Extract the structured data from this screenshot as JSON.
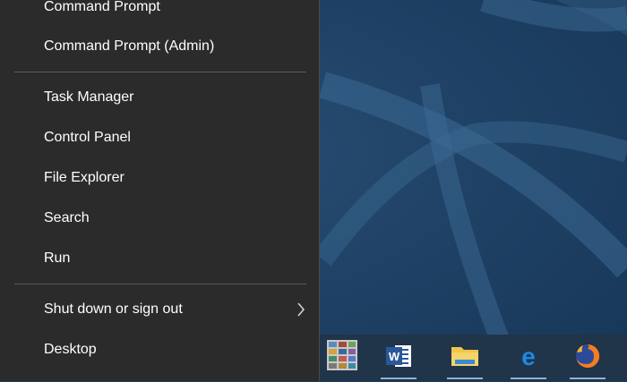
{
  "menu": {
    "items": [
      {
        "label": "Command Prompt"
      },
      {
        "label": "Command Prompt (Admin)"
      },
      {
        "label": "Task Manager"
      },
      {
        "label": "Control Panel"
      },
      {
        "label": "File Explorer"
      },
      {
        "label": "Search"
      },
      {
        "label": "Run"
      },
      {
        "label": "Shut down or sign out"
      },
      {
        "label": "Desktop"
      }
    ],
    "shutdown_submenu_icon": "chevron-right-icon"
  },
  "taskbar": {
    "icons": [
      {
        "name": "gallery-app-icon"
      },
      {
        "name": "word-icon",
        "letter": "W"
      },
      {
        "name": "file-explorer-icon"
      },
      {
        "name": "edge-icon",
        "letter": "e"
      },
      {
        "name": "firefox-icon"
      }
    ]
  },
  "colors": {
    "menu_bg": "#2b2b2b",
    "menu_text": "#ffffff",
    "desktop_bg": "#1f4266",
    "taskbar_bg": "#20344a"
  }
}
